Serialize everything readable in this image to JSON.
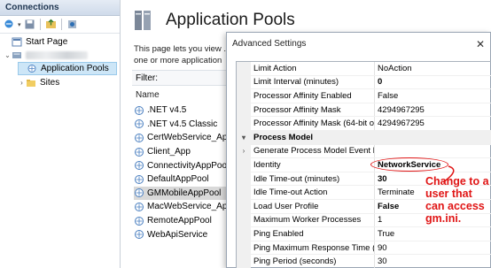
{
  "connections": {
    "header": "Connections",
    "tree": {
      "start_page": "Start Page",
      "application_pools": "Application Pools",
      "sites": "Sites"
    }
  },
  "main": {
    "title": "Application Pools",
    "description": "This page lets you view ... one or more application",
    "filter_label": "Filter:",
    "column_name": "Name",
    "pools": [
      ".NET v4.5",
      ".NET v4.5 Classic",
      "CertWebService_App",
      "Client_App",
      "ConnectivityAppPoo",
      "DefaultAppPool",
      "GMMobileAppPool",
      "MacWebService_App",
      "RemoteAppPool",
      "WebApiService"
    ],
    "selected_pool_index": 6
  },
  "dialog": {
    "title": "Advanced Settings",
    "rows": [
      {
        "name": "Limit Action",
        "value": "NoAction",
        "bold": false,
        "gutter": ""
      },
      {
        "name": "Limit Interval (minutes)",
        "value": "0",
        "bold": true,
        "gutter": ""
      },
      {
        "name": "Processor Affinity Enabled",
        "value": "False",
        "bold": false,
        "gutter": ""
      },
      {
        "name": "Processor Affinity Mask",
        "value": "4294967295",
        "bold": false,
        "gutter": ""
      },
      {
        "name": "Processor Affinity Mask (64-bit o",
        "value": "4294967295",
        "bold": false,
        "gutter": ""
      },
      {
        "category": "Process Model",
        "gutter": "▾"
      },
      {
        "name": "Generate Process Model Event L",
        "value": "",
        "bold": false,
        "gutter": "›"
      },
      {
        "name": "Identity",
        "value": "NetworkService",
        "bold": true,
        "gutter": ""
      },
      {
        "name": "Idle Time-out (minutes)",
        "value": "30",
        "bold": true,
        "gutter": ""
      },
      {
        "name": "Idle Time-out Action",
        "value": "Terminate",
        "bold": false,
        "gutter": ""
      },
      {
        "name": "Load User Profile",
        "value": "False",
        "bold": true,
        "gutter": ""
      },
      {
        "name": "Maximum Worker Processes",
        "value": "1",
        "bold": false,
        "gutter": ""
      },
      {
        "name": "Ping Enabled",
        "value": "True",
        "bold": false,
        "gutter": ""
      },
      {
        "name": "Ping Maximum Response Time (",
        "value": "90",
        "bold": false,
        "gutter": ""
      },
      {
        "name": "Ping Period (seconds)",
        "value": "30",
        "bold": false,
        "gutter": ""
      }
    ]
  },
  "annotation": {
    "text": "Change to a user that can access gm.ini.",
    "color": "#e01515"
  }
}
